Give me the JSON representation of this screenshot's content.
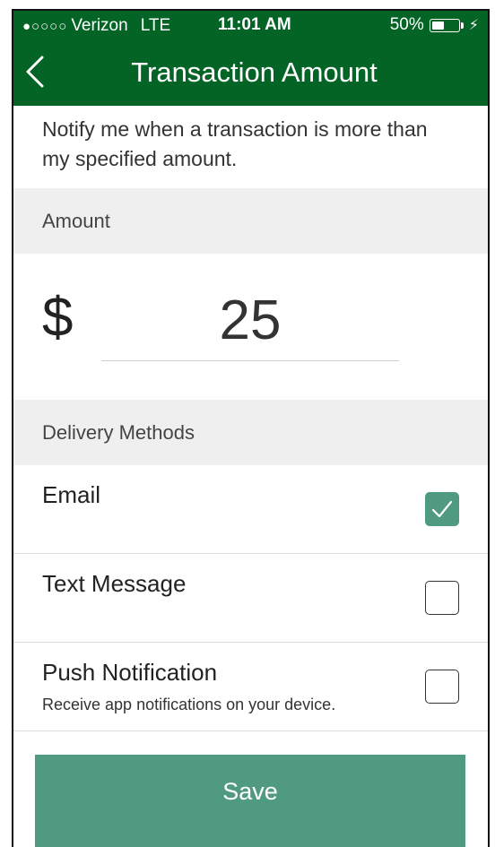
{
  "status_bar": {
    "signal": "●○○○○",
    "carrier": "Verizon",
    "network": "LTE",
    "time": "11:01 AM",
    "battery_text": "50%",
    "battery_level": 0.5,
    "charging_icon": "bolt-icon"
  },
  "nav": {
    "back_icon": "chevron-left-icon",
    "title": "Transaction Amount"
  },
  "intro_text": "Notify me when a transaction is more than my specified amount.",
  "amount_section": {
    "header": "Amount",
    "currency_symbol": "$",
    "value": "25"
  },
  "delivery_section": {
    "header": "Delivery Methods",
    "methods": [
      {
        "label": "Email",
        "description": "",
        "checked": true
      },
      {
        "label": "Text Message",
        "description": "",
        "checked": false
      },
      {
        "label": "Push Notification",
        "description": "Receive app notifications on your device.",
        "checked": false
      }
    ]
  },
  "save_label": "Save",
  "colors": {
    "brand_green": "#036426",
    "accent_green": "#4f9a80",
    "section_gray": "#efefef"
  }
}
